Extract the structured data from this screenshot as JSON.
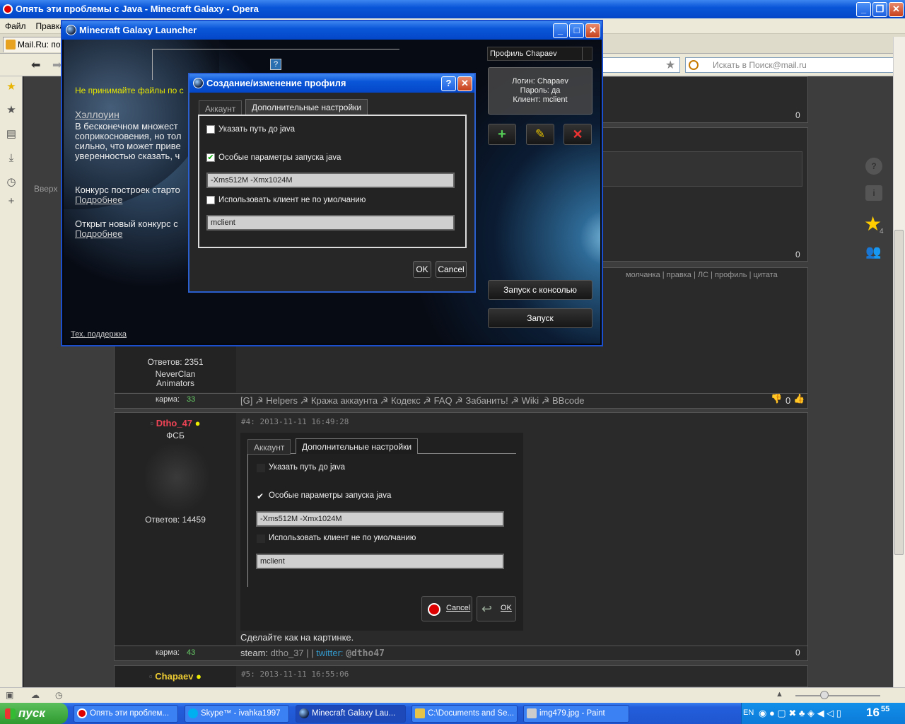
{
  "opera": {
    "title": "Опять эти проблемы с Java - Minecraft Galaxy - Opera",
    "menu": [
      "Файл",
      "Правка"
    ],
    "tab_label": "Mail.Ru: поч",
    "search_placeholder": "Искать в Поиск@mail.ru",
    "sidebar_text": "Вверх"
  },
  "forum": {
    "row0_count": "0",
    "row1_count": "0",
    "post_actions": "молчанка | правка | ЛС | профиль | цитата",
    "post3": {
      "answers": "Ответов: 2351",
      "clan_line1": "NeverClan",
      "clan_line2": "Animators",
      "karma_label": "карма:",
      "karma_value": "33",
      "links": "[G] ☭ Helpers ☭ Кража аккаунта ☭ Кодекс ☭ FAQ ☭ Забанить! ☭ Wiki ☭ BBcode",
      "vote_count": "0"
    },
    "post4": {
      "author": "Dtho_47",
      "rank": "ФСБ",
      "answers": "Ответов: 14459",
      "header": "#4: 2013-11-11 16:49:28",
      "img_tab_account": "Аккаунт",
      "img_tab_advanced": "Дополнительные настройки",
      "img_chk_java_path": "Указать путь до java",
      "img_chk_java_params": "Особые параметры запуска java",
      "img_params_value": "-Xms512M -Xmx1024M",
      "img_chk_client": "Использовать клиент не по умолчанию",
      "img_client_value": "mclient",
      "img_cancel": "Cancel",
      "img_ok": "OK",
      "text": "Сделайте как на картинке.",
      "karma_label": "карма:",
      "karma_value": "43",
      "sig_steam": "steam:",
      "sig_steam_value": "dtho_37",
      "sig_sep": "| |",
      "sig_twitter": "twitter:",
      "sig_twitter_value": "@dtho47",
      "count": "0"
    },
    "post5": {
      "author": "Chapaev",
      "header": "#5: 2013-11-11 16:55:06"
    },
    "rating_value": "4"
  },
  "launcher": {
    "title": "Minecraft Galaxy Launcher",
    "warning": "Не принимайте файлы по с",
    "news1_title": "Хэллоуин",
    "news1_line1": "В бесконечном множест",
    "news1_line2": "соприкосновения, но тол",
    "news1_line3": "сильно, что может приве",
    "news1_line4": "уверенностью сказать, ч",
    "news2_text": "Конкурс построек старто",
    "news2_link": "Подробнее",
    "news3_text": "Открыт новый конкурс с",
    "news3_link": "Подробнее",
    "support_link": "Тех. поддержка",
    "profile_select": "Профиль Chapaev",
    "login": "Логин: Chapaev",
    "password": "Пароль: да",
    "client": "Клиент: mclient",
    "launch_console": "Запуск с консолью",
    "launch": "Запуск"
  },
  "dialog": {
    "title": "Создание/изменение профиля",
    "tab_account": "Аккаунт",
    "tab_advanced": "Дополнительные настройки",
    "chk_java_path": "Указать путь до java",
    "chk_java_params": "Особые параметры запуска java",
    "params_value": "-Xms512M -Xmx1024M",
    "chk_client": "Использовать клиент не по умолчанию",
    "client_value": "mclient",
    "ok": "OK",
    "cancel": "Cancel"
  },
  "taskbar": {
    "start": "пуск",
    "tasks": [
      "Опять эти проблем...",
      "Skype™ - ivahka1997",
      "Minecraft Galaxy Lau...",
      "C:\\Documents and Se...",
      "img479.jpg - Paint"
    ],
    "lang": "EN",
    "clock_h": "16",
    "clock_m": "55"
  }
}
